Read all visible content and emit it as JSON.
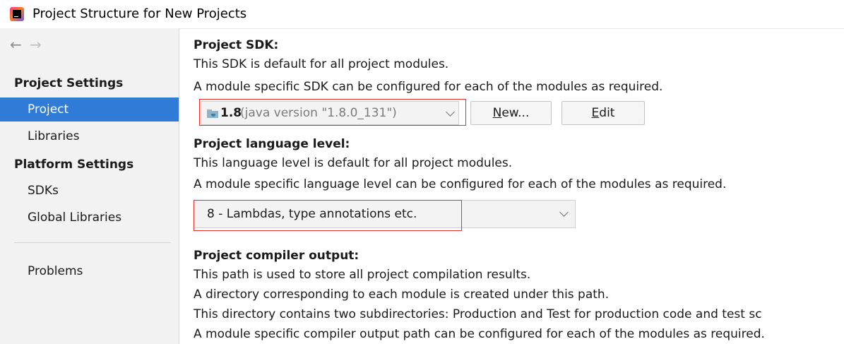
{
  "window": {
    "title": "Project Structure for New Projects",
    "app_icon": "intellij-idea-icon"
  },
  "nav": {
    "back_glyph": "←",
    "forward_glyph": "→"
  },
  "sidebar": {
    "project_settings_label": "Project Settings",
    "project_items": [
      {
        "label": "Project",
        "selected": true
      },
      {
        "label": "Libraries",
        "selected": false
      }
    ],
    "platform_settings_label": "Platform Settings",
    "platform_items": [
      {
        "label": "SDKs",
        "selected": false
      },
      {
        "label": "Global Libraries",
        "selected": false
      }
    ],
    "problems_label": "Problems"
  },
  "sdk_section": {
    "heading": "Project SDK:",
    "line1": "This SDK is default for all project modules.",
    "line2": "A module specific SDK can be configured for each of the modules as required.",
    "combo_version": "1.8",
    "combo_detail": "(java version \"1.8.0_131\")",
    "new_button": "New...",
    "new_mnemonic": "N",
    "new_rest": "ew...",
    "edit_button": "Edit",
    "edit_mnemonic": "E",
    "edit_rest": "dit"
  },
  "language_section": {
    "heading": "Project language level:",
    "line1": "This language level is default for all project modules.",
    "line2": "A module specific language level can be configured for each of the modules as required.",
    "selected_level": "8 - Lambdas, type annotations etc."
  },
  "compiler_section": {
    "heading": "Project compiler output:",
    "line1": "This path is used to store all project compilation results.",
    "line2": "A directory corresponding to each module is created under this path.",
    "line3": "This directory contains two subdirectories: Production and Test for production code and test sc",
    "line4": "A module specific compiler output path can be configured for each of the modules as required."
  },
  "colors": {
    "selection": "#2f7bd6",
    "sidebar_bg": "#f2f2f2",
    "highlight_box": "#e0312b"
  }
}
